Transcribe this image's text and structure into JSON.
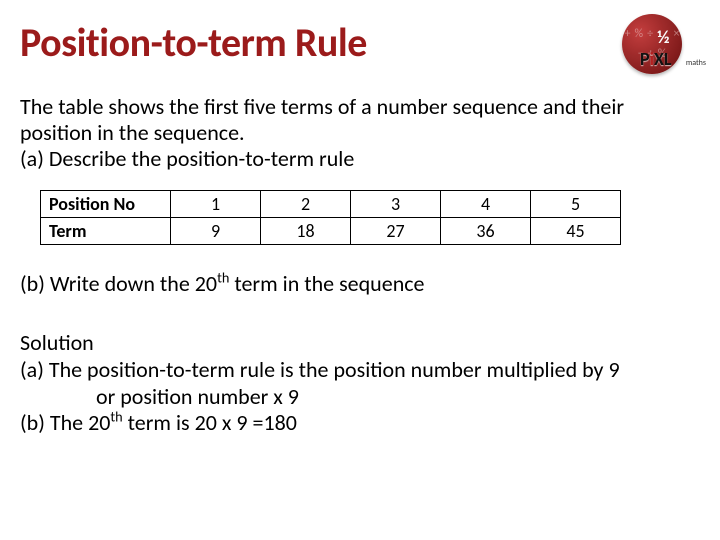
{
  "title": "Position-to-term Rule",
  "logo": {
    "brand_p": "P",
    "brand_i": "i",
    "brand_xl": "XL",
    "sub": "maths"
  },
  "intro": {
    "line1": "The table shows the first five terms of a number sequence and their",
    "line2": "position in the sequence.",
    "line3": "(a) Describe the position-to-term rule"
  },
  "table": {
    "row_labels": [
      "Position No",
      "Term"
    ],
    "cols": [
      "1",
      "2",
      "3",
      "4",
      "5"
    ],
    "terms": [
      "9",
      "18",
      "27",
      "36",
      "45"
    ]
  },
  "part_b_pre": "(b) Write down the 20",
  "part_b_sup": "th",
  "part_b_post": " term in the sequence",
  "solution": {
    "heading": "Solution",
    "a1": "(a)  The position-to-term rule is the position number multiplied by 9",
    "a2": "or position number x 9",
    "b_pre": "(b)  The 20",
    "b_sup": "th",
    "b_post": " term is 20 x 9 =180"
  },
  "chart_data": {
    "type": "table",
    "title": "Position-to-term sequence",
    "columns": [
      "Position No",
      "Term"
    ],
    "rows": [
      [
        1,
        9
      ],
      [
        2,
        18
      ],
      [
        3,
        27
      ],
      [
        4,
        36
      ],
      [
        5,
        45
      ]
    ],
    "rule": "term = position × 9",
    "twentieth_term": 180
  }
}
